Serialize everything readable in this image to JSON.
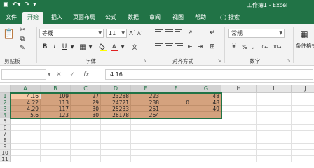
{
  "title": "工作簿1 - Excel",
  "tabs": [
    {
      "label": "文件",
      "active": false
    },
    {
      "label": "开始",
      "active": true
    },
    {
      "label": "插入",
      "active": false
    },
    {
      "label": "页面布局",
      "active": false
    },
    {
      "label": "公式",
      "active": false
    },
    {
      "label": "数据",
      "active": false
    },
    {
      "label": "审阅",
      "active": false
    },
    {
      "label": "视图",
      "active": false
    },
    {
      "label": "帮助",
      "active": false
    }
  ],
  "search_label": "搜索",
  "ribbon": {
    "groups": {
      "clipboard": "剪贴板",
      "font": "字体",
      "alignment": "对齐方式",
      "number": "数字"
    },
    "font_name": "等线",
    "font_size": "11",
    "number_format": "常规",
    "cond_format_label": "条件格式"
  },
  "formula_bar": {
    "name_box": "",
    "formula": "4.16"
  },
  "sheet": {
    "columns": [
      "A",
      "B",
      "C",
      "D",
      "E",
      "F",
      "G",
      "H",
      "I",
      "J"
    ],
    "rows": [
      "1",
      "2",
      "3",
      "4",
      "5",
      "6",
      "7",
      "8",
      "9",
      "10",
      "11"
    ],
    "cells": [
      [
        "4.16",
        "109",
        "27",
        "23288",
        "223",
        "",
        "48"
      ],
      [
        "4.22",
        "113",
        "29",
        "24721",
        "238",
        "0",
        "48"
      ],
      [
        "4.29",
        "117",
        "30",
        "25233",
        "251",
        "",
        "49"
      ],
      [
        "5.6",
        "123",
        "30",
        "26178",
        "264",
        "",
        ""
      ]
    ]
  },
  "colors": {
    "brand": "#217346",
    "fill": "#d4a27e",
    "fill_first": "#f7c9a6"
  }
}
